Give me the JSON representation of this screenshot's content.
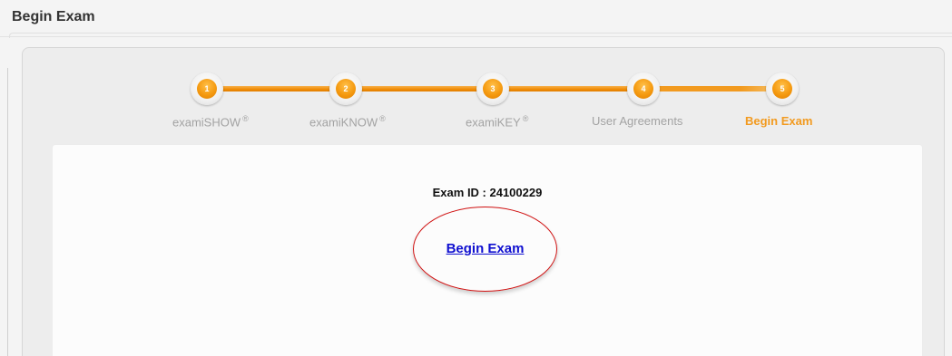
{
  "header": {
    "title": "Begin Exam"
  },
  "steps": [
    {
      "number": "1",
      "label": "examiSHOW",
      "reg": "®"
    },
    {
      "number": "2",
      "label": "examiKNOW",
      "reg": "®"
    },
    {
      "number": "3",
      "label": "examiKEY",
      "reg": "®"
    },
    {
      "number": "4",
      "label": "User Agreements",
      "reg": ""
    },
    {
      "number": "5",
      "label": "Begin Exam",
      "reg": ""
    }
  ],
  "active_step": 5,
  "main": {
    "exam_id": "Exam ID : 24100229",
    "begin_link": "Begin Exam"
  },
  "colors": {
    "accent": "#f29a1f",
    "link": "#1010d0",
    "highlight": "#d01010"
  }
}
